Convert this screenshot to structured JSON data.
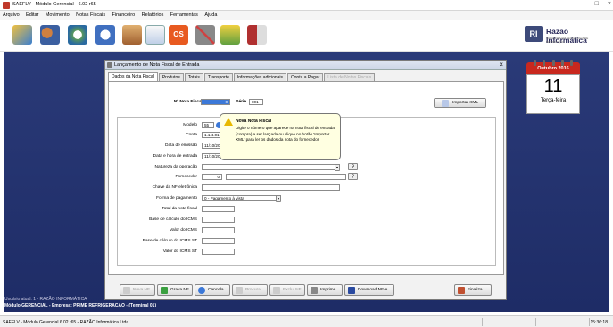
{
  "window": {
    "title": "SAEFLV - Módulo Gerencial - 6.02 r65"
  },
  "menu": [
    "Arquivo",
    "Editar",
    "Movimento",
    "Notas Fiscais",
    "Financeiro",
    "Relatórios",
    "Ferramentas",
    "Ajuda"
  ],
  "logo": {
    "mark": "RI",
    "name": "Razão Informática",
    "tagline": "SOLUÇÕES EM TECNOLOGIA DE INFORMAÇÃO"
  },
  "calendar": {
    "month": "Outubro 2016",
    "day": "11",
    "weekday": "Terça-feira"
  },
  "dialog": {
    "title": "Lançamento de Nota Fiscal de Entrada",
    "tabs": [
      "Dados da Nota Fiscal",
      "Produtos",
      "Totais",
      "Transporte",
      "Informações adicionais",
      "Conta a Pagar",
      "Lista de Notas Fiscais"
    ],
    "numero_label": "Nº Nota Fiscal",
    "numero_value": "0",
    "serie_label": "Série",
    "serie_value": "001",
    "importar_label": "Importar XML",
    "fields": {
      "modelo_label": "Modelo",
      "modelo_value": "55",
      "conta_label": "Conta",
      "conta_value": "1.1.4.01",
      "emissao_label": "Data de emissão",
      "emissao_value": "11/10/20",
      "entrada_label": "Data e hora de entrada",
      "entrada_value": "11/10/20",
      "natureza_label": "Natureza da operação",
      "fornecedor_label": "Fornecedor",
      "fornecedor_value": "0",
      "chave_label": "Chave da NF eletrônica",
      "pagamento_label": "Forma de pagamento",
      "pagamento_value": "0 - Pagamento à vista",
      "total_label": "Total da nota fiscal",
      "base_icms_label": "Base de cálculo do ICMS",
      "valor_icms_label": "Valor do ICMS",
      "base_st_label": "Base de cálculo do ICMS ST",
      "valor_st_label": "Valor do ICMS ST"
    },
    "buttons": {
      "nova": "Nova NF",
      "grava": "Grava NF",
      "cancela": "Cancela",
      "procura": "Procura",
      "exclui": "Exclui NF",
      "imprime": "Imprime",
      "download": "Download NF-e",
      "finaliza": "Finaliza"
    }
  },
  "tooltip": {
    "title": "Nova Nota Fiscal",
    "body": "Digite o número que aparece na nota fiscal de entrada (compra) a ser lançada ou clique no botão 'Importar XML' para ler os dados da nota do fornecedor."
  },
  "status": {
    "user": "Usuário atual: 1 - RAZÃO INFORMÁTICA",
    "company": "Módulo GERENCIAL - Empresa: PRIME REFRIGERACAO - (Terminal 01)",
    "bar_text": "SAEFLV - Módulo Gerencial 6.02 r65 - RAZÃO Informática Ltda.",
    "time": "15:36:18"
  },
  "colors": {
    "desktop": "#1e2c66",
    "calendar": "#c8281e",
    "tooltip": "#ffffe1"
  }
}
